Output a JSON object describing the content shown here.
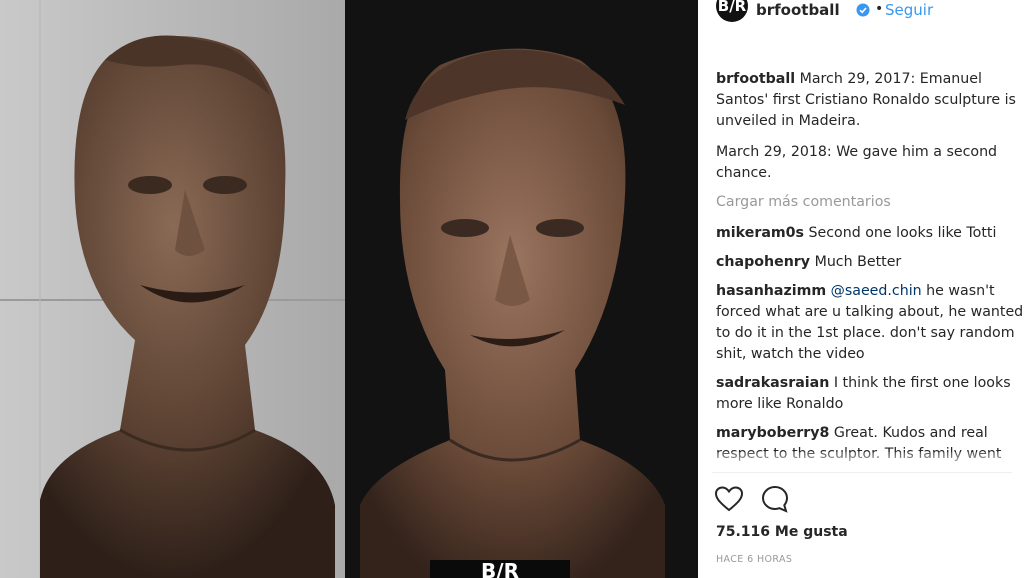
{
  "post": {
    "username": "brfootball",
    "avatar_text": "B/R",
    "follow_label": "Seguir",
    "verified_icon": "verified-badge-icon"
  },
  "caption": {
    "username": "brfootball",
    "text_1": "March 29, 2017: Emanuel Santos' first Cristiano Ronaldo sculpture is unveiled in Madeira.",
    "text_2": "March 29, 2018: We gave him a second chance."
  },
  "load_more_label": "Cargar más comentarios",
  "comments": [
    {
      "user": "mikeram0s",
      "text": "Second one looks like Totti"
    },
    {
      "user": "chapohenry",
      "text": "Much Better"
    },
    {
      "user": "hasanhazimm",
      "mention": "@saeed.chin",
      "text": "he wasn't forced what are u talking about, he wanted to do it in the 1st place. don't say random shit, watch the video"
    },
    {
      "user": "sadrakasraian",
      "text": "I think the first one looks more like Ronaldo"
    },
    {
      "user": "maryboberry8",
      "text": "Great. Kudos and real respect to the sculptor. This family went"
    }
  ],
  "photo": {
    "plinth_text": "B/R"
  },
  "actions": {
    "like_icon": "heart-icon",
    "comment_icon": "comment-bubble-icon",
    "likes_text": "75.116 Me gusta",
    "time_text": "HACE 6 HORAS"
  },
  "colors": {
    "link": "#3897f0",
    "muted": "#999999",
    "bronze": "#6b4a36"
  }
}
